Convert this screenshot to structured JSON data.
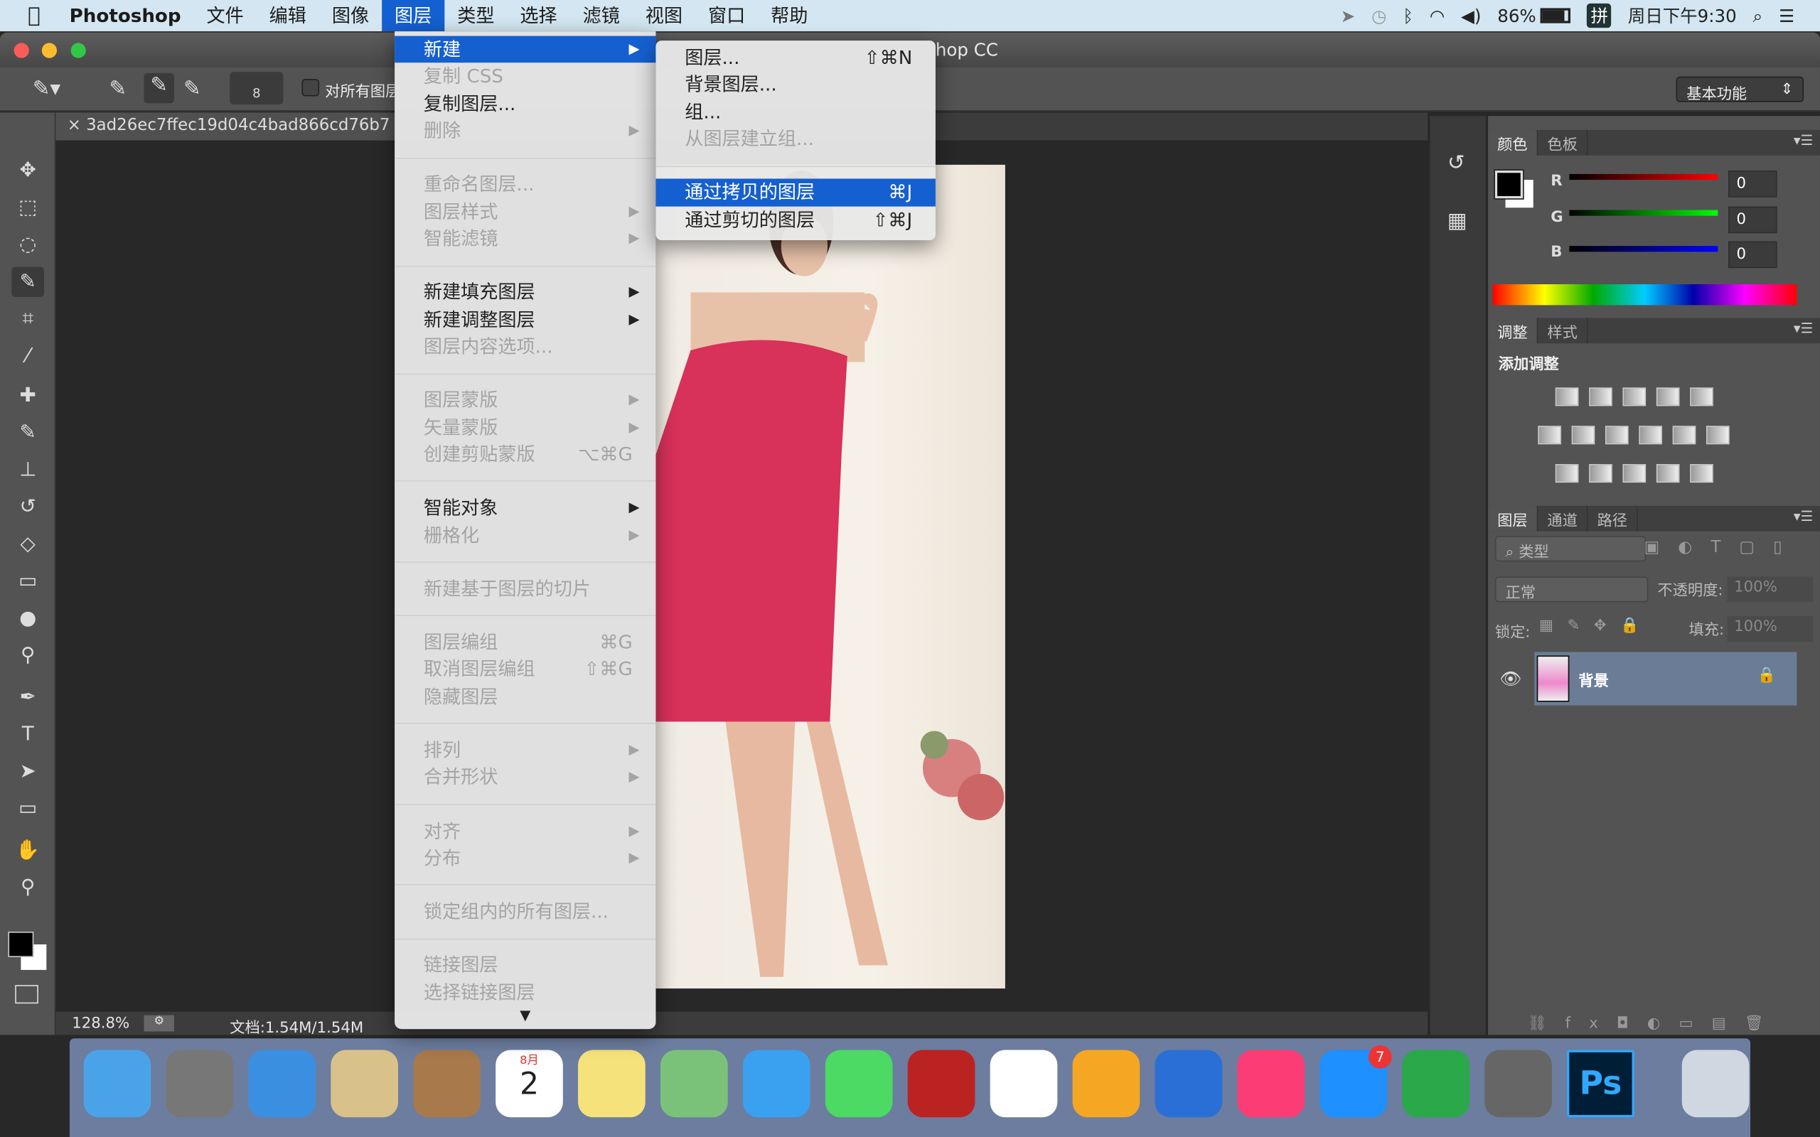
{
  "menubar": {
    "app": "Photoshop",
    "items": [
      "文件",
      "编辑",
      "图像",
      "图层",
      "类型",
      "选择",
      "滤镜",
      "视图",
      "窗口",
      "帮助"
    ],
    "active_index": 3
  },
  "status": {
    "battery": "86%",
    "input_method": "拼",
    "clock": "周日下午9:30"
  },
  "window": {
    "title": "hop CC"
  },
  "options": {
    "brush_size": "8",
    "sample_all_label": "对所有图层",
    "workspace": "基本功能"
  },
  "document": {
    "tab": "3ad26ec7ffec19d04c4bad866cd76b7",
    "zoom": "128.8%",
    "docsize": "文档:1.54M/1.54M"
  },
  "layer_menu": [
    {
      "label": "新建",
      "arrow": true,
      "hl": true
    },
    {
      "label": "复制 CSS",
      "dis": true
    },
    {
      "label": "复制图层..."
    },
    {
      "label": "删除",
      "dis": true,
      "arrow": true
    },
    {
      "sep": true
    },
    {
      "label": "重命名图层...",
      "dis": true
    },
    {
      "label": "图层样式",
      "dis": true,
      "arrow": true
    },
    {
      "label": "智能滤镜",
      "dis": true,
      "arrow": true
    },
    {
      "sep": true
    },
    {
      "label": "新建填充图层",
      "arrow": true
    },
    {
      "label": "新建调整图层",
      "arrow": true
    },
    {
      "label": "图层内容选项...",
      "dis": true
    },
    {
      "sep": true
    },
    {
      "label": "图层蒙版",
      "dis": true,
      "arrow": true
    },
    {
      "label": "矢量蒙版",
      "dis": true,
      "arrow": true
    },
    {
      "label": "创建剪贴蒙版",
      "dis": true,
      "shortcut": "⌥⌘G"
    },
    {
      "sep": true
    },
    {
      "label": "智能对象",
      "arrow": true
    },
    {
      "label": "栅格化",
      "dis": true,
      "arrow": true
    },
    {
      "sep": true
    },
    {
      "label": "新建基于图层的切片",
      "dis": true
    },
    {
      "sep": true
    },
    {
      "label": "图层编组",
      "dis": true,
      "shortcut": "⌘G"
    },
    {
      "label": "取消图层编组",
      "dis": true,
      "shortcut": "⇧⌘G"
    },
    {
      "label": "隐藏图层",
      "dis": true
    },
    {
      "sep": true
    },
    {
      "label": "排列",
      "dis": true,
      "arrow": true
    },
    {
      "label": "合并形状",
      "dis": true,
      "arrow": true
    },
    {
      "sep": true
    },
    {
      "label": "对齐",
      "dis": true,
      "arrow": true
    },
    {
      "label": "分布",
      "dis": true,
      "arrow": true
    },
    {
      "sep": true
    },
    {
      "label": "锁定组内的所有图层...",
      "dis": true
    },
    {
      "sep": true
    },
    {
      "label": "链接图层",
      "dis": true
    },
    {
      "label": "选择链接图层",
      "dis": true
    }
  ],
  "new_submenu": [
    {
      "label": "图层...",
      "shortcut": "⇧⌘N"
    },
    {
      "label": "背景图层..."
    },
    {
      "label": "组..."
    },
    {
      "label": "从图层建立组...",
      "dis": true
    },
    {
      "sep": true
    },
    {
      "label": "通过拷贝的图层",
      "shortcut": "⌘J",
      "hl": true
    },
    {
      "label": "通过剪切的图层",
      "shortcut": "⇧⌘J"
    }
  ],
  "color_panel": {
    "tabs": [
      "颜色",
      "色板"
    ],
    "r_label": "R",
    "g_label": "G",
    "b_label": "B",
    "r": "0",
    "g": "0",
    "b": "0",
    "foreground": "#000000",
    "background": "#ffffff"
  },
  "adjust_panel": {
    "tabs": [
      "调整",
      "样式"
    ],
    "heading": "添加调整"
  },
  "layers_panel": {
    "tabs": [
      "图层",
      "通道",
      "路径"
    ],
    "filter": "类型",
    "blend": "正常",
    "opacity_label": "不透明度:",
    "opacity": "100%",
    "lock_label": "锁定:",
    "fill_label": "填充:",
    "fill": "100%",
    "layers": [
      {
        "name": "背景",
        "visible": true,
        "locked": true
      }
    ]
  },
  "dock": {
    "apps": [
      "finder",
      "launchpad",
      "safari",
      "mail",
      "contacts",
      "calendar",
      "notes",
      "maps",
      "messages",
      "facetime",
      "photo-booth",
      "photos",
      "pages",
      "keynote",
      "itunes",
      "app-store",
      "telegram",
      "system-preferences",
      "photoshop",
      "trash"
    ],
    "calendar_month": "8月",
    "calendar_day": "2",
    "app_store_badge": "7",
    "ps_label": "Ps"
  }
}
